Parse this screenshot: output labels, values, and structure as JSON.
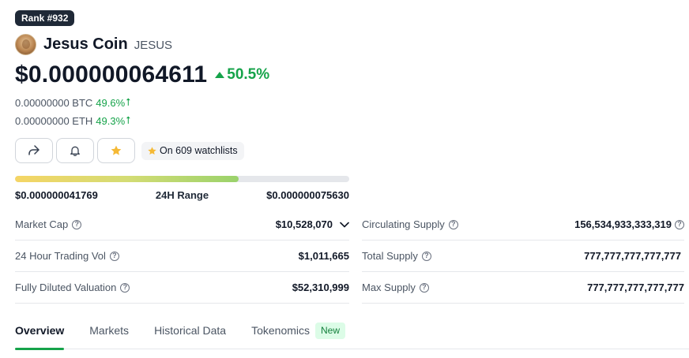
{
  "rank_label": "Rank #932",
  "coin": {
    "name": "Jesus Coin",
    "symbol": "JESUS"
  },
  "price": {
    "usd": "$0.000000064611",
    "change_24h": "50.5%",
    "btc_value": "0.00000000 BTC",
    "btc_change": "49.6%",
    "eth_value": "0.00000000 ETH",
    "eth_change": "49.3%",
    "up_arrow": "⭡"
  },
  "actions": {
    "watchlist_label": "On 609 watchlists"
  },
  "range_24h": {
    "low": "$0.000000041769",
    "label": "24H Range",
    "high": "$0.000000075630",
    "current_fraction": 0.67
  },
  "stats_left": [
    {
      "label": "Market Cap",
      "value": "$10,528,070"
    },
    {
      "label": "24 Hour Trading Vol",
      "value": "$1,011,665"
    },
    {
      "label": "Fully Diluted Valuation",
      "value": "$52,310,999"
    }
  ],
  "stats_right": [
    {
      "label": "Circulating Supply",
      "value": "156,534,933,333,319"
    },
    {
      "label": "Total Supply",
      "value": "777,777,777,777,777"
    },
    {
      "label": "Max Supply",
      "value": "777,777,777,777,777"
    }
  ],
  "tabs": [
    {
      "label": "Overview"
    },
    {
      "label": "Markets"
    },
    {
      "label": "Historical Data"
    },
    {
      "label": "Tokenomics",
      "badge": "New"
    }
  ],
  "colors": {
    "up": "#16a34a",
    "star": "#f5b935",
    "tab_active": "#16a34a"
  },
  "icons": {
    "share": "share-icon",
    "bell": "bell-icon",
    "star": "star-icon",
    "info": "info-icon",
    "chevron": "chevron-down-icon"
  }
}
